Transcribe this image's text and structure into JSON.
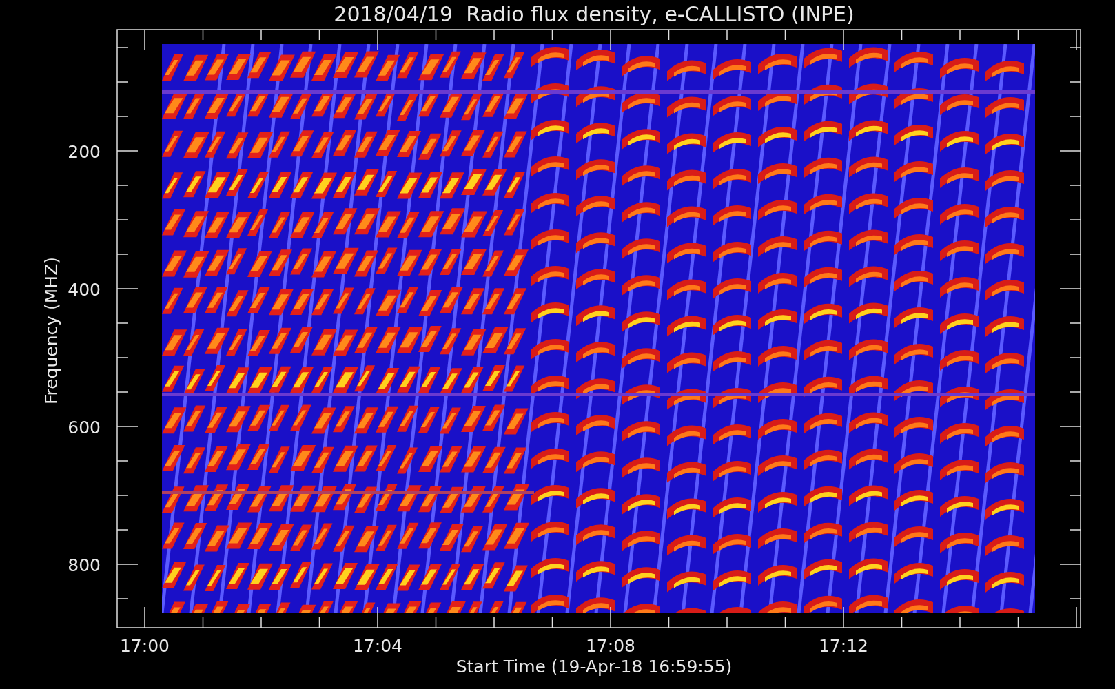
{
  "title": "2018/04/19  Radio flux density, e-CALLISTO (INPE)",
  "y_axis": {
    "label": "Frequency (MHZ)",
    "ticks": [
      "200",
      "400",
      "600",
      "800"
    ]
  },
  "x_axis": {
    "label": "Start Time (19-Apr-18 16:59:55)",
    "ticks": [
      "17:00",
      "17:04",
      "17:08",
      "17:12"
    ]
  }
}
